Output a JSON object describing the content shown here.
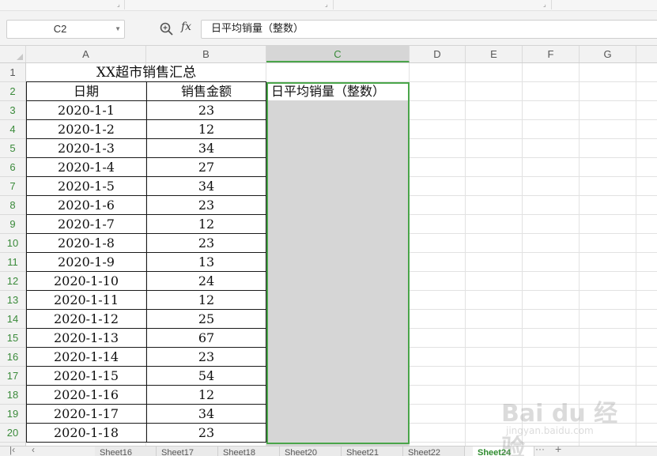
{
  "formula_bar": {
    "name_box": "C2",
    "fx_label": "fx",
    "formula_text": "日平均销量（整数）"
  },
  "columns": [
    "A",
    "B",
    "C",
    "D",
    "E",
    "F",
    "G"
  ],
  "rows": [
    "1",
    "2",
    "3",
    "4",
    "5",
    "6",
    "7",
    "8",
    "9",
    "10",
    "11",
    "12",
    "13",
    "14",
    "15",
    "16",
    "17",
    "18",
    "19",
    "20"
  ],
  "sheet": {
    "title": "XX超市销售汇总",
    "headers": [
      "日期",
      "销售金额",
      "日平均销量（整数）"
    ],
    "records": [
      {
        "date": "2020-1-1",
        "amount": "23"
      },
      {
        "date": "2020-1-2",
        "amount": "12"
      },
      {
        "date": "2020-1-3",
        "amount": "34"
      },
      {
        "date": "2020-1-4",
        "amount": "27"
      },
      {
        "date": "2020-1-5",
        "amount": "34"
      },
      {
        "date": "2020-1-6",
        "amount": "23"
      },
      {
        "date": "2020-1-7",
        "amount": "12"
      },
      {
        "date": "2020-1-8",
        "amount": "23"
      },
      {
        "date": "2020-1-9",
        "amount": "13"
      },
      {
        "date": "2020-1-10",
        "amount": "24"
      },
      {
        "date": "2020-1-11",
        "amount": "12"
      },
      {
        "date": "2020-1-12",
        "amount": "25"
      },
      {
        "date": "2020-1-13",
        "amount": "67"
      },
      {
        "date": "2020-1-14",
        "amount": "23"
      },
      {
        "date": "2020-1-15",
        "amount": "54"
      },
      {
        "date": "2020-1-16",
        "amount": "12"
      },
      {
        "date": "2020-1-17",
        "amount": "34"
      },
      {
        "date": "2020-1-18",
        "amount": "23"
      }
    ]
  },
  "sheet_tabs": [
    "Sheet16",
    "Sheet17",
    "Sheet18",
    "Sheet20",
    "Sheet21",
    "Sheet22",
    "Sheet24"
  ],
  "active_tab": "Sheet24",
  "sheet_bar": {
    "more": "···",
    "add": "+"
  },
  "watermark": {
    "text": "Bai du 经验",
    "sub": "jingyan.baidu.com"
  },
  "colors": {
    "selection_border": "#4aa54a",
    "selection_fill": "#d6d6d6",
    "active_tab_text": "#2e8b2e"
  },
  "icons": {
    "zoom": "zoom-search-icon",
    "name_box_dropdown": "chevron-down-icon",
    "sheet_prev": "chevron-left-icon",
    "sheet_first": "first-sheet-icon"
  }
}
